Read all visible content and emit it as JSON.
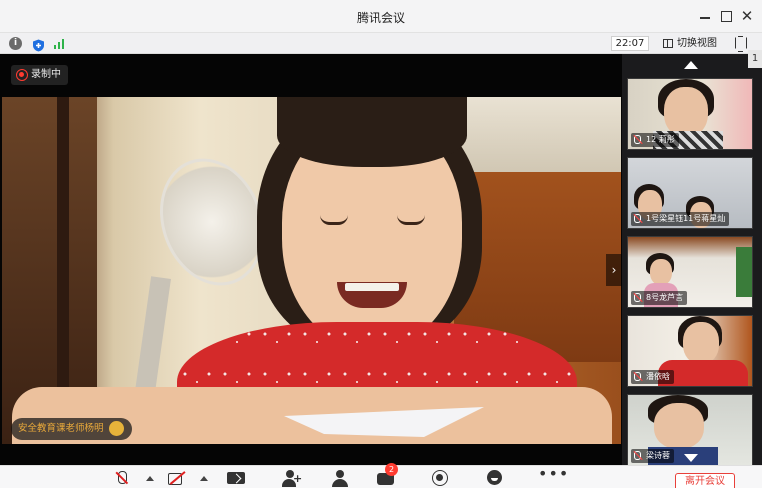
{
  "window": {
    "title": "腾讯会议"
  },
  "statusbar": {
    "time": "22:07",
    "switch_view_label": "切换视图"
  },
  "main": {
    "recording_label": "录制中",
    "speaker_label": "安全教育课老师杨明"
  },
  "panel": {
    "edge_label": "1",
    "participants": [
      {
        "name": "12 莉彤"
      },
      {
        "name": "1号梁星钰11号蒋星灿"
      },
      {
        "name": "8号龙芦言"
      },
      {
        "name": "潘依晗"
      },
      {
        "name": "梁诗蓉"
      }
    ]
  },
  "toolbar": {
    "chat_badge": "2",
    "leave_label": "离开会议"
  },
  "colors": {
    "accent_red": "#e8403a",
    "record_red": "#ff3b30",
    "signal_green": "#2eb34a",
    "shield_blue": "#1f6fe0",
    "speaker_gold": "#e9a93a"
  },
  "icons": [
    "info-icon",
    "shield-icon",
    "signal-icon",
    "grid-icon",
    "fullscreen-icon",
    "record-icon",
    "clap-icon",
    "mic-muted-icon",
    "camera-off-icon",
    "share-screen-icon",
    "invite-icon",
    "members-icon",
    "chat-icon",
    "record-button-icon",
    "emoji-icon",
    "more-icon"
  ]
}
